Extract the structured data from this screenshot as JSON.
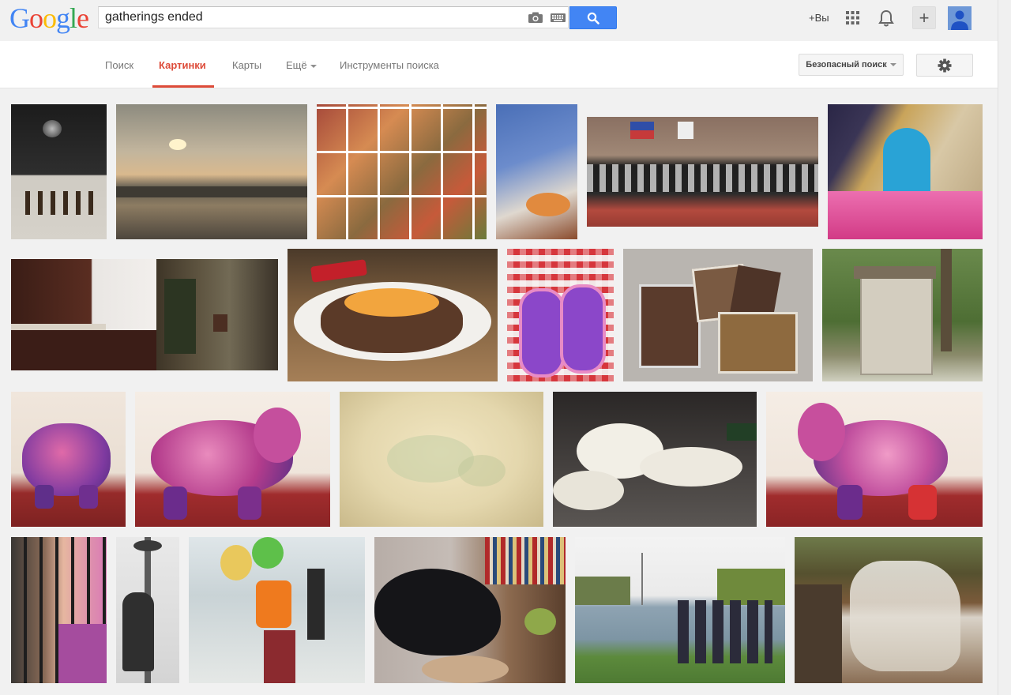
{
  "logo": [
    "G",
    "o",
    "o",
    "g",
    "l",
    "e"
  ],
  "colors": {
    "logo": [
      "#4285f4",
      "#ea4335",
      "#fbbc05",
      "#4285f4",
      "#34a853",
      "#ea4335"
    ],
    "accent": "#dd4b39",
    "search_button": "#4285f4"
  },
  "search": {
    "query": "gatherings ended"
  },
  "header": {
    "plus_you": "+Вы"
  },
  "nav": {
    "tabs": [
      "Поиск",
      "Картинки",
      "Карты",
      "Ещё",
      "Инструменты поиска"
    ],
    "active_tab": "Картинки",
    "safe_search": "Безопасный поиск"
  },
  "icons": [
    "camera-icon",
    "keyboard-icon",
    "search-icon",
    "apps-grid-icon",
    "bell-icon",
    "plus-icon",
    "avatar-icon",
    "gear-icon"
  ]
}
